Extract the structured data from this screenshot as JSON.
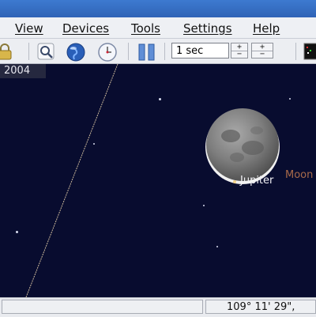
{
  "menu": {
    "items": [
      {
        "label": "View"
      },
      {
        "label": "Devices"
      },
      {
        "label": "Tools"
      },
      {
        "label": "Settings"
      },
      {
        "label": "Help"
      }
    ]
  },
  "toolbar": {
    "time_step": "1 sec",
    "spin_up": "+",
    "spin_down": "−",
    "spin2_up": "+",
    "spin2_down": "−"
  },
  "sky": {
    "date_label": "2004",
    "jupiter_label": "Jupiter",
    "moon_label": "Moon"
  },
  "status": {
    "coordinates": "109° 11' 29\","
  },
  "colors": {
    "sky_background": "#080c2f",
    "moon_label": "#a86a4a",
    "title_bar": "#2f63b6"
  }
}
